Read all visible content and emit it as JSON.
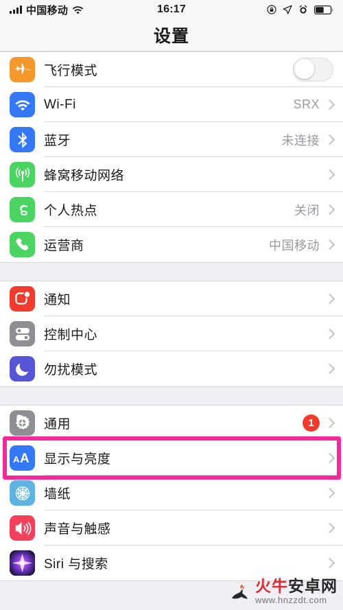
{
  "status_bar": {
    "carrier": "中国移动",
    "time": "16:17",
    "signal_icon": "signal-bars-icon",
    "wifi_icon": "wifi-icon",
    "rotation_lock_icon": "rotation-lock-icon",
    "location_icon": "location-arrow-icon",
    "alarm_icon": "alarm-clock-icon",
    "battery_icon": "battery-icon"
  },
  "header": {
    "title": "设置"
  },
  "groups": [
    {
      "id": "connectivity",
      "rows": [
        {
          "name": "airplane-mode",
          "icon": "airplane-icon",
          "icon_color": "#f5982b",
          "label": "飞行模式",
          "control": "toggle",
          "toggle_on": false
        },
        {
          "name": "wifi",
          "icon": "wifi-icon",
          "icon_color": "#3478f6",
          "label": "Wi-Fi",
          "value": "SRX",
          "control": "chevron"
        },
        {
          "name": "bluetooth",
          "icon": "bluetooth-icon",
          "icon_color": "#3478f6",
          "label": "蓝牙",
          "value": "未连接",
          "control": "chevron"
        },
        {
          "name": "cellular",
          "icon": "cellular-antenna-icon",
          "icon_color": "#4cd462",
          "label": "蜂窝移动网络",
          "value": "",
          "control": "chevron"
        },
        {
          "name": "personal-hotspot",
          "icon": "hotspot-link-icon",
          "icon_color": "#4cd462",
          "label": "个人热点",
          "value": "关闭",
          "control": "chevron"
        },
        {
          "name": "carrier",
          "icon": "phone-icon",
          "icon_color": "#4cd462",
          "label": "运营商",
          "value": "中国移动",
          "control": "chevron"
        }
      ]
    },
    {
      "id": "alerts",
      "rows": [
        {
          "name": "notifications",
          "icon": "notification-icon",
          "icon_color": "#f03b2f",
          "label": "通知",
          "value": "",
          "control": "chevron"
        },
        {
          "name": "control-center",
          "icon": "control-center-icon",
          "icon_color": "#8e8e93",
          "label": "控制中心",
          "value": "",
          "control": "chevron"
        },
        {
          "name": "do-not-disturb",
          "icon": "moon-icon",
          "icon_color": "#5856d6",
          "label": "勿扰模式",
          "value": "",
          "control": "chevron"
        }
      ]
    },
    {
      "id": "system",
      "rows": [
        {
          "name": "general",
          "icon": "gear-icon",
          "icon_color": "#8e8e93",
          "label": "通用",
          "badge": "1",
          "control": "chevron"
        },
        {
          "name": "display-brightness",
          "icon": "aa-text-icon",
          "icon_color": "#3478f6",
          "label": "显示与亮度",
          "value": "",
          "control": "chevron",
          "highlighted": true
        },
        {
          "name": "wallpaper",
          "icon": "flower-icon",
          "icon_color": "#5fb3e0",
          "label": "墙纸",
          "value": "",
          "control": "chevron"
        },
        {
          "name": "sounds-haptics",
          "icon": "speaker-icon",
          "icon_color": "#f3415c",
          "label": "声音与触感",
          "value": "",
          "control": "chevron"
        },
        {
          "name": "siri-search",
          "icon": "siri-orb-icon",
          "icon_color": "#3a2a5e",
          "label": "Siri 与搜索",
          "value": "",
          "control": "chevron"
        }
      ]
    }
  ],
  "highlight": {
    "target": "显示与亮度",
    "color": "#f22a9b"
  },
  "watermark": {
    "name_red": "火牛",
    "name_dark": "安卓网",
    "url": "www.hnzzdt.com"
  }
}
